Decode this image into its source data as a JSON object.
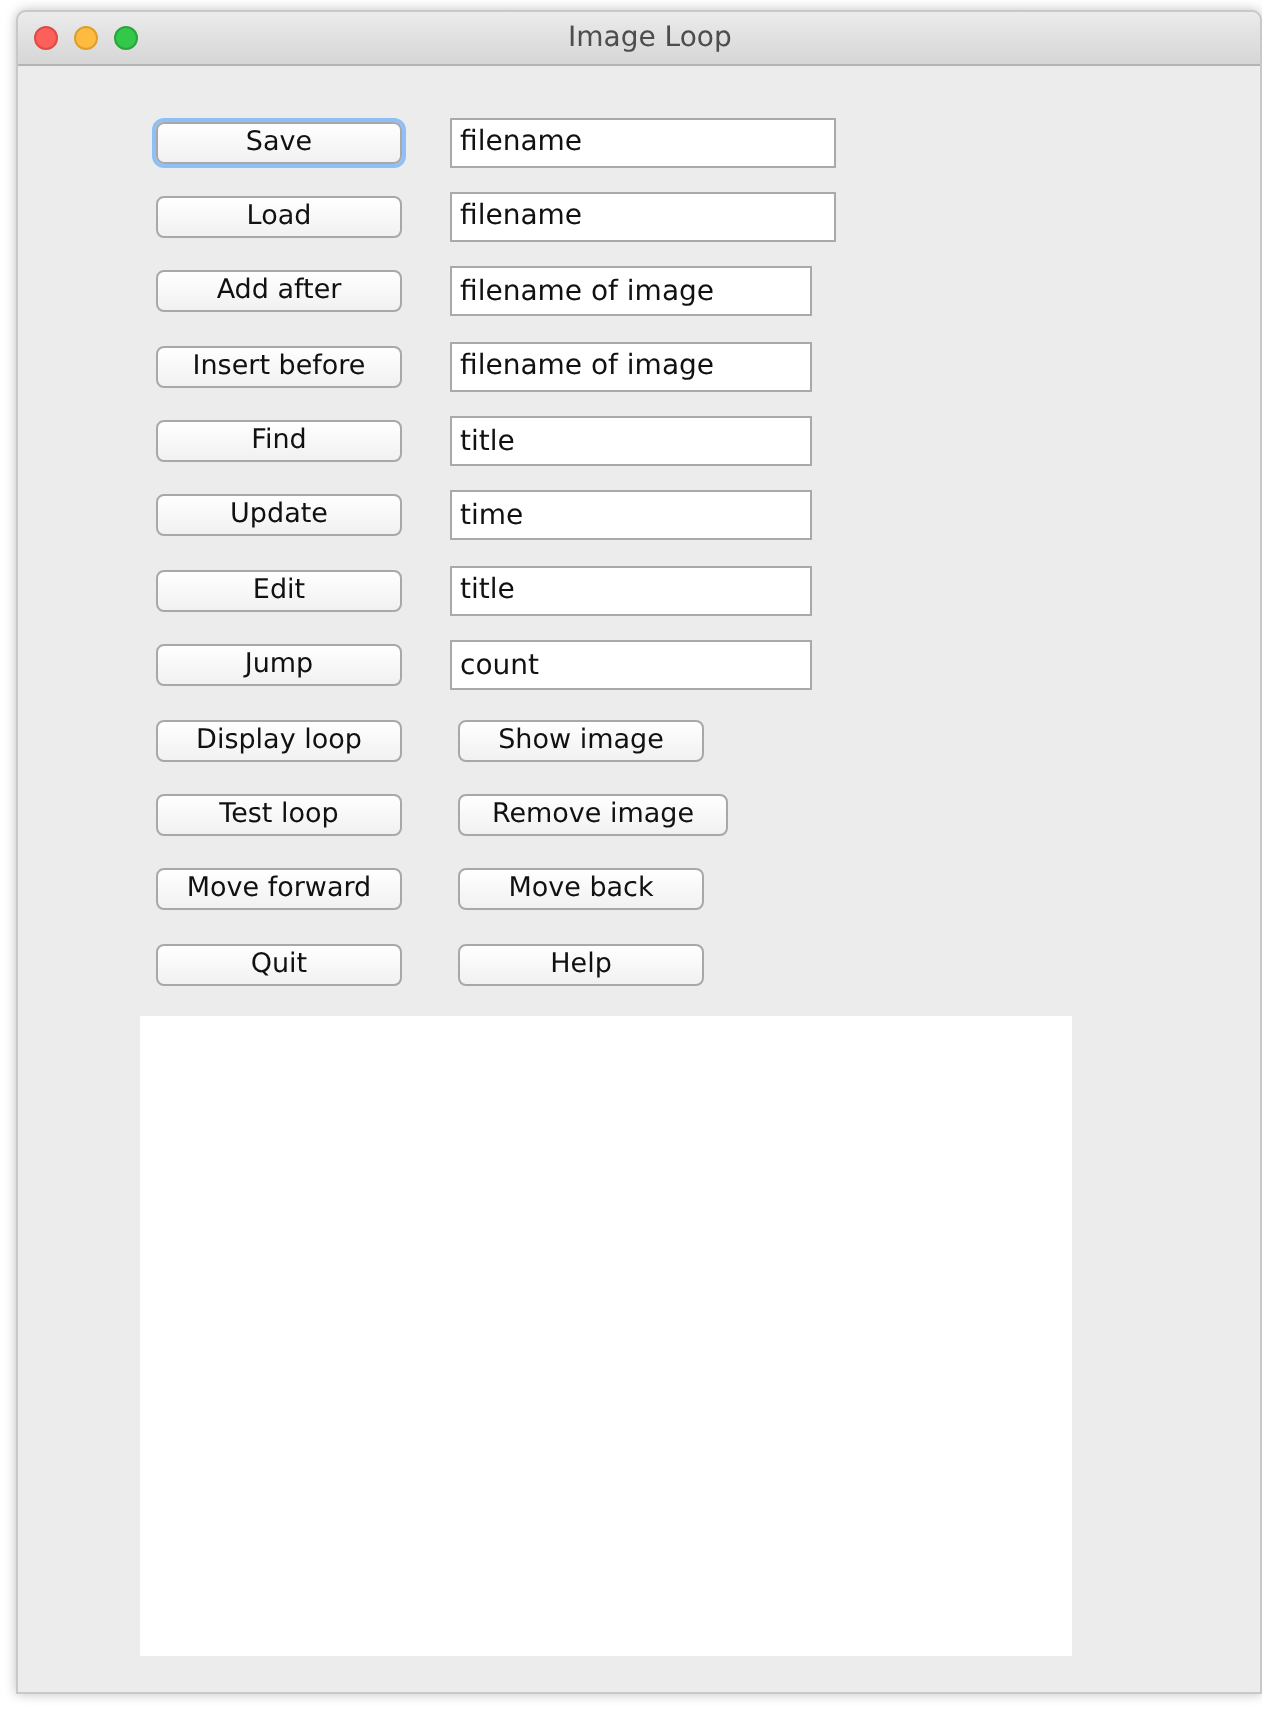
{
  "window": {
    "title": "Image Loop"
  },
  "rows": [
    {
      "button": {
        "label": "Save",
        "focused": true
      },
      "second": {
        "kind": "field",
        "value": "filename",
        "wide": true
      }
    },
    {
      "button": {
        "label": "Load",
        "focused": false
      },
      "second": {
        "kind": "field",
        "value": "filename",
        "wide": true
      }
    },
    {
      "button": {
        "label": "Add after",
        "focused": false
      },
      "second": {
        "kind": "field",
        "value": "filename of image",
        "wide": false
      }
    },
    {
      "button": {
        "label": "Insert before",
        "focused": false
      },
      "second": {
        "kind": "field",
        "value": "filename of image",
        "wide": false
      }
    },
    {
      "button": {
        "label": "Find",
        "focused": false
      },
      "second": {
        "kind": "field",
        "value": "title",
        "wide": false
      }
    },
    {
      "button": {
        "label": "Update",
        "focused": false
      },
      "second": {
        "kind": "field",
        "value": "time",
        "wide": false
      }
    },
    {
      "button": {
        "label": "Edit",
        "focused": false
      },
      "second": {
        "kind": "field",
        "value": "title",
        "wide": false
      }
    },
    {
      "button": {
        "label": "Jump",
        "focused": false
      },
      "second": {
        "kind": "field",
        "value": "count",
        "wide": false
      }
    },
    {
      "button": {
        "label": "Display loop",
        "focused": false
      },
      "second": {
        "kind": "button",
        "label": "Show image",
        "wide": false
      }
    },
    {
      "button": {
        "label": "Test loop",
        "focused": false
      },
      "second": {
        "kind": "button",
        "label": "Remove image",
        "wide": true
      }
    },
    {
      "button": {
        "label": "Move forward",
        "focused": false
      },
      "second": {
        "kind": "button",
        "label": "Move back",
        "wide": false
      }
    },
    {
      "button": {
        "label": "Quit",
        "focused": false
      },
      "second": {
        "kind": "button",
        "label": "Help",
        "wide": false
      }
    }
  ]
}
